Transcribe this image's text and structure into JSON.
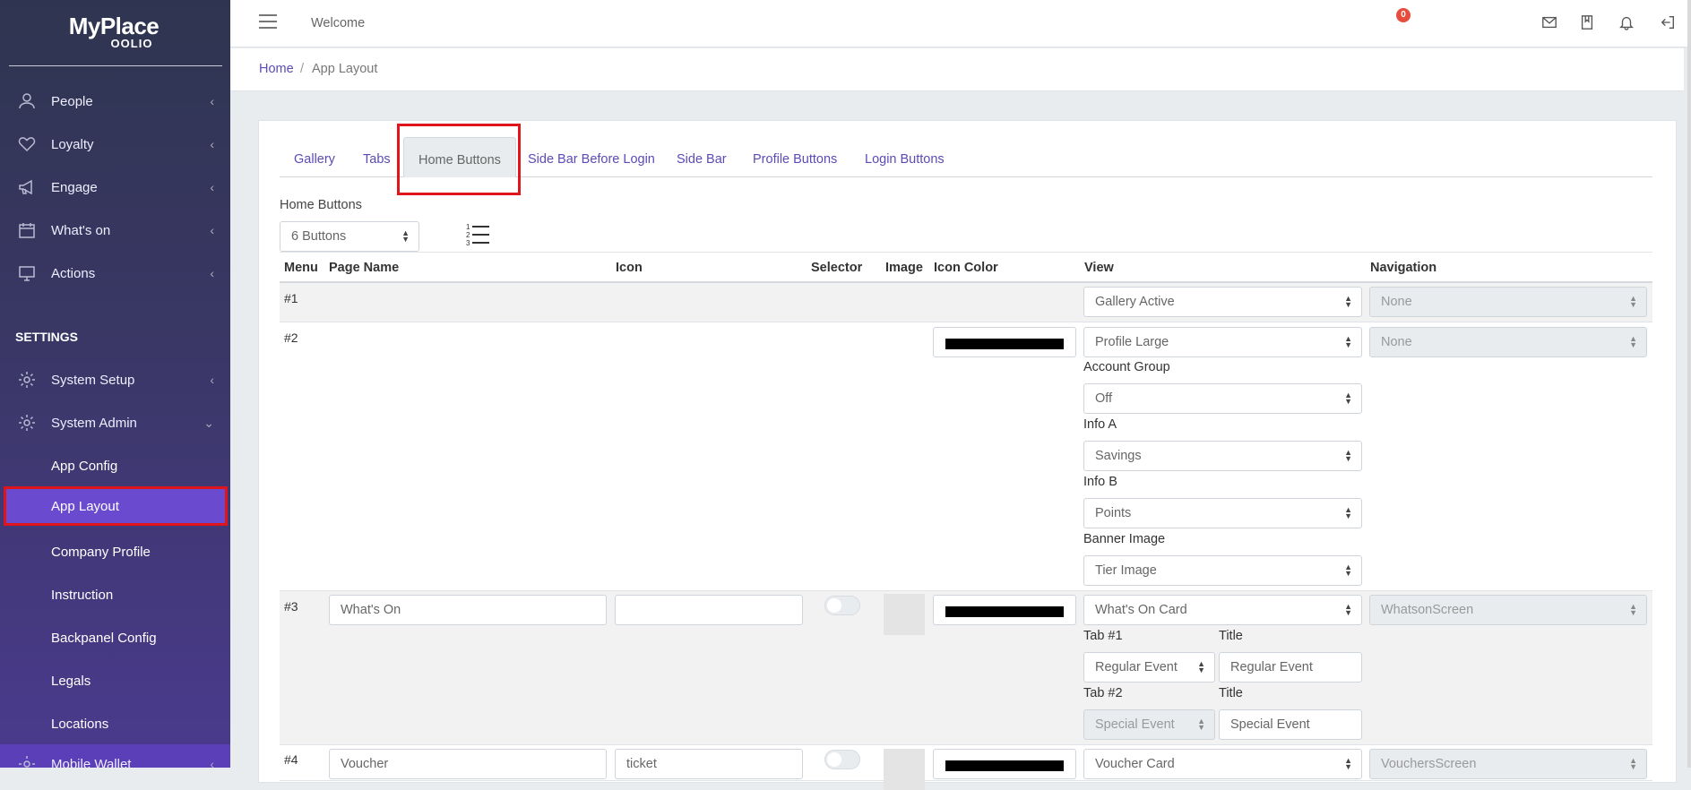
{
  "brand": {
    "name": "MyPlace",
    "sub": "OOLIO"
  },
  "sidebar": {
    "items": [
      {
        "label": "People",
        "icon": "person-icon"
      },
      {
        "label": "Loyalty",
        "icon": "heart-icon"
      },
      {
        "label": "Engage",
        "icon": "megaphone-icon"
      },
      {
        "label": "What's on",
        "icon": "calendar-icon"
      },
      {
        "label": "Actions",
        "icon": "monitor-icon"
      }
    ],
    "settings_heading": "SETTINGS",
    "settings_items": [
      {
        "label": "System Setup",
        "icon": "gear-icon"
      },
      {
        "label": "System Admin",
        "icon": "gear-icon"
      }
    ],
    "admin_sub": [
      "App Config",
      "App Layout",
      "Company Profile",
      "Instruction",
      "Backpanel Config",
      "Legals",
      "Locations"
    ],
    "bottom_item": "Mobile Wallet"
  },
  "topbar": {
    "welcome": "Welcome",
    "notif_count": "0"
  },
  "breadcrumb": {
    "home": "Home",
    "sep": "/",
    "current": "App Layout"
  },
  "tabs": [
    "Gallery",
    "Tabs",
    "Home Buttons",
    "Side Bar Before Login",
    "Side Bar",
    "Profile Buttons",
    "Login Buttons"
  ],
  "home_buttons": {
    "label": "Home Buttons",
    "count_select": "6 Buttons"
  },
  "table": {
    "headers": [
      "Menu",
      "Page Name",
      "Icon",
      "Selector",
      "Image",
      "Icon Color",
      "View",
      "Navigation"
    ],
    "rows": [
      {
        "num": "#1",
        "view": "Gallery Active",
        "navigation": "None"
      },
      {
        "num": "#2",
        "view": "Profile Large",
        "navigation": "None",
        "account_group_label": "Account Group",
        "account_group": "Off",
        "info_a_label": "Info A",
        "info_a": "Savings",
        "info_b_label": "Info B",
        "info_b": "Points",
        "banner_label": "Banner Image",
        "banner": "Tier Image"
      },
      {
        "num": "#3",
        "page_name": "What's On",
        "icon": "",
        "view": "What's On Card",
        "navigation": "WhatsonScreen",
        "tab1_label": "Tab #1",
        "tab1": "Regular Event",
        "title1_label": "Title",
        "title1": "Regular Event",
        "tab2_label": "Tab #2",
        "tab2": "Special Event",
        "title2_label": "Title",
        "title2": "Special Event"
      },
      {
        "num": "#4",
        "page_name": "Voucher",
        "icon": "ticket",
        "view": "Voucher Card",
        "navigation": "VouchersScreen"
      }
    ]
  },
  "colors": {
    "accent": "#5a4bb8",
    "active_nav": "#6a4bd0",
    "highlight": "#e0151b"
  }
}
